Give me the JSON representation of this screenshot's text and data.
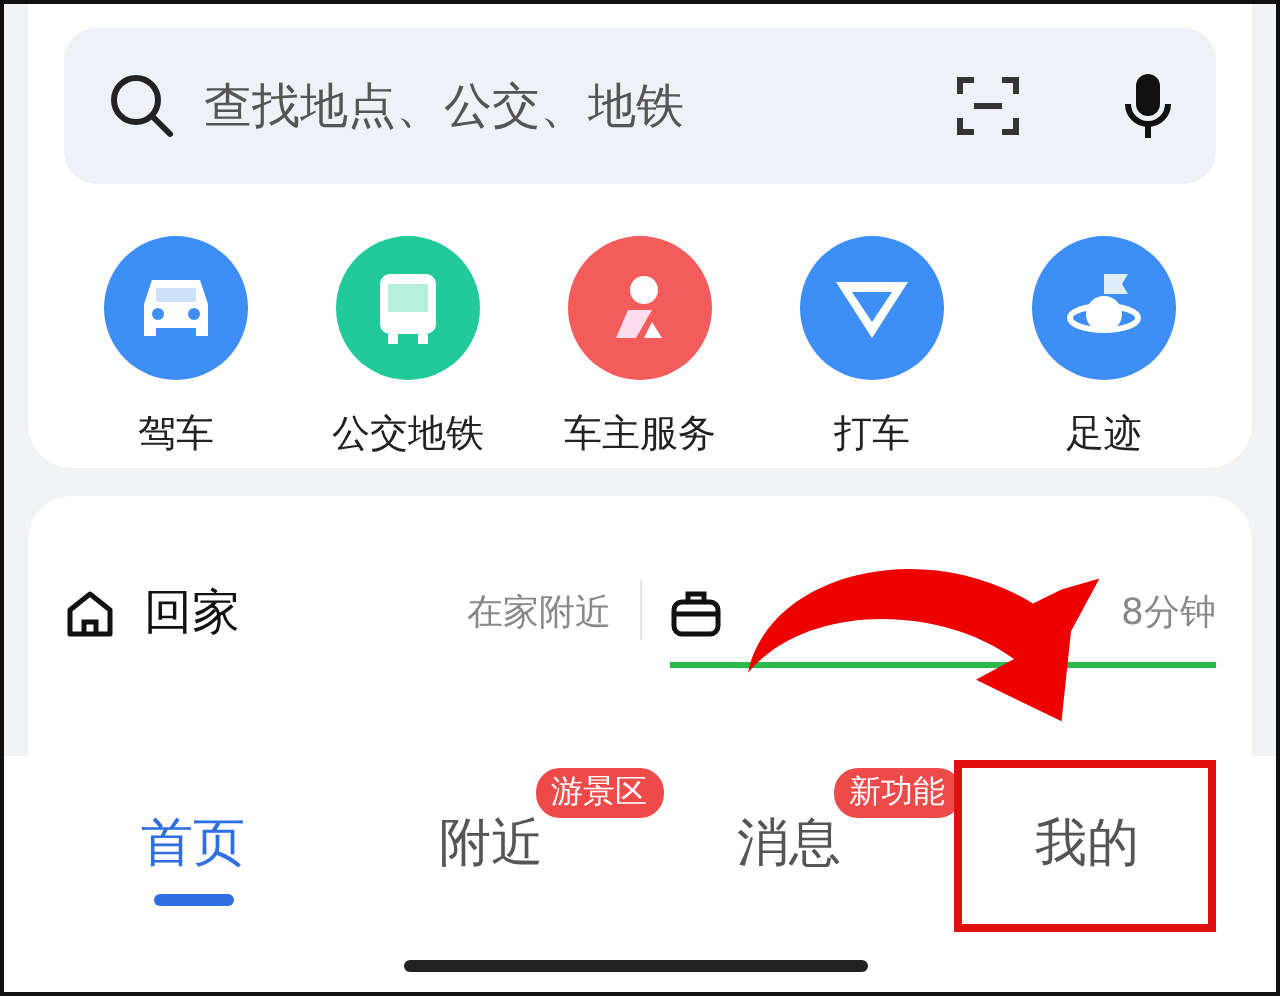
{
  "search": {
    "placeholder": "查找地点、公交、地铁"
  },
  "shortcuts": [
    {
      "label": "驾车",
      "kind": "car",
      "color": "#3d8ff5"
    },
    {
      "label": "公交地铁",
      "kind": "bus",
      "color": "#22c99a"
    },
    {
      "label": "车主服务",
      "kind": "owner",
      "color": "#f45b5b"
    },
    {
      "label": "打车",
      "kind": "taxi",
      "color": "#3d8ff5"
    },
    {
      "label": "足迹",
      "kind": "footprint",
      "color": "#3d8ff5"
    }
  ],
  "places": [
    {
      "kind": "home",
      "label": "回家",
      "note": "在家附近"
    },
    {
      "kind": "work",
      "note": "8分钟"
    }
  ],
  "tabs": [
    {
      "label": "首页",
      "selected": true
    },
    {
      "label": "附近",
      "selected": false,
      "badge": "游景区"
    },
    {
      "label": "消息",
      "selected": false,
      "badge": "新功能"
    },
    {
      "label": "我的",
      "selected": false,
      "highlighted": true
    }
  ]
}
